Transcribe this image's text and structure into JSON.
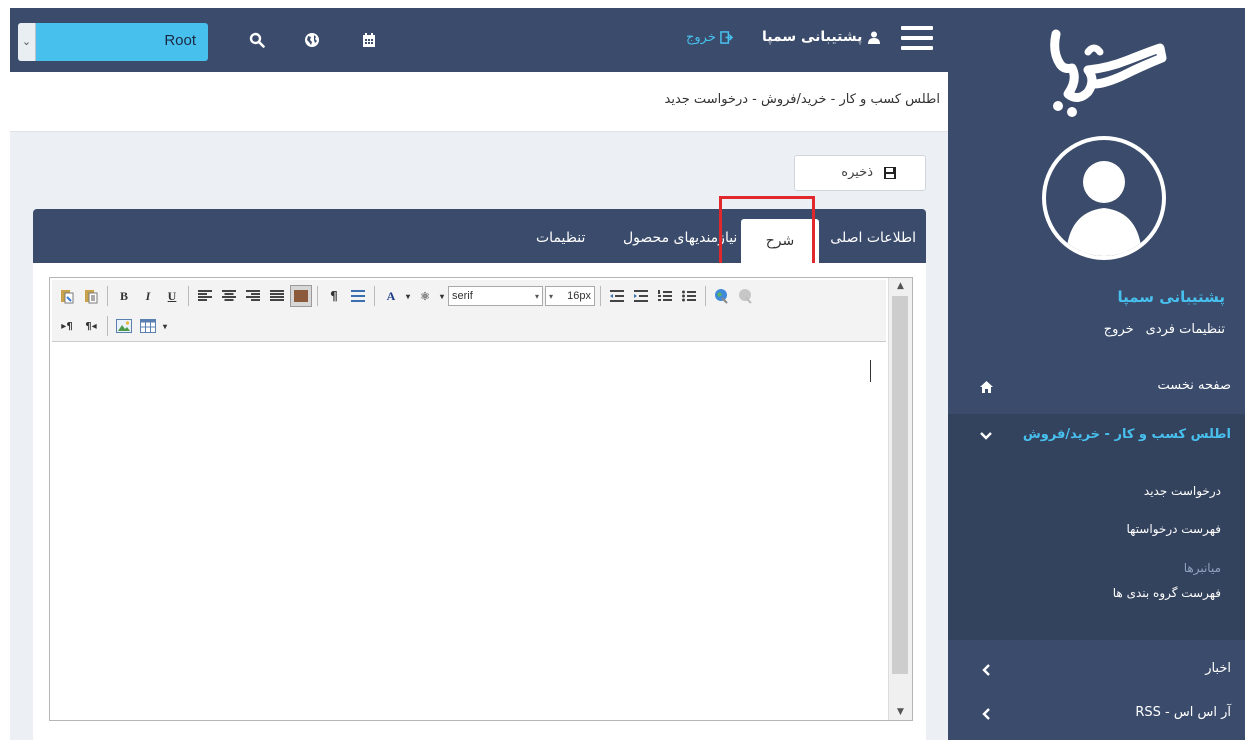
{
  "topbar": {
    "root_select_value": "Root",
    "user_name": "پشتیبانی سمپا",
    "logout_label": "خروج"
  },
  "breadcrumb": "اطلس کسب و کار - خرید/فروش - درخواست جدید",
  "toolbar": {
    "save_label": "ذخیره"
  },
  "tabs": [
    {
      "label": "اطلاعات اصلی"
    },
    {
      "label": "شرح",
      "active": true
    },
    {
      "label": "نیازمندیهای محصول"
    },
    {
      "label": "تنظیمات"
    }
  ],
  "editor": {
    "font_family": "serif",
    "font_size": "16px"
  },
  "sidebar": {
    "user_name": "پشتیبانی سمپا",
    "personal_settings": "تنظیمات فردی",
    "logout": "خروج",
    "nav": {
      "home": "صفحه نخست",
      "atlas": "اطلس کسب و کار - خرید/فروش",
      "news": "اخبار",
      "rss": "آر اس اس - RSS"
    },
    "submenu": {
      "new_request": "درخواست جدید",
      "request_list": "فهرست درخواستها",
      "brokers": "میانبرها",
      "group_list": "فهرست گروه بندی ها"
    }
  },
  "colors": {
    "header_navy": "#3a4b6b",
    "accent_cyan": "#48c0ee",
    "highlight_red": "#e0282d"
  }
}
